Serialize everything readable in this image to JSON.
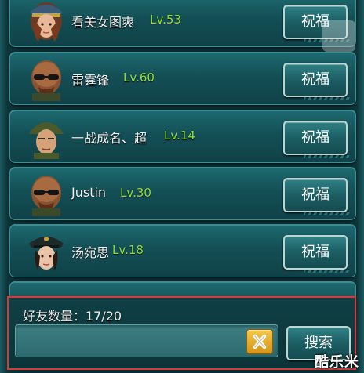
{
  "friends": [
    {
      "name": "看美女图爽",
      "level": "Lv.53",
      "button": "祝福",
      "avatar": "female-pilot-avatar"
    },
    {
      "name": "雷霆锋",
      "level": "Lv.60",
      "button": "祝福",
      "avatar": "bald-sunglasses-avatar"
    },
    {
      "name": "一战成名、超",
      "level": "Lv.14",
      "button": "祝福",
      "avatar": "helmet-soldier-avatar"
    },
    {
      "name": "Justin",
      "level": "Lv.30",
      "button": "祝福",
      "avatar": "bald-sunglasses-avatar"
    },
    {
      "name": "汤宛思",
      "level": "Lv.18",
      "button": "祝福",
      "avatar": "female-officer-avatar"
    }
  ],
  "footer": {
    "friend_count_label": "好友数量：17/20",
    "search_placeholder": "",
    "search_button": "搜索"
  },
  "watermark": "酷乐米",
  "colors": {
    "level_green": "#8fe03c",
    "panel_teal": "#134f55",
    "highlight_red": "#d33a3a",
    "clear_button_gold": "#e0a52a"
  }
}
